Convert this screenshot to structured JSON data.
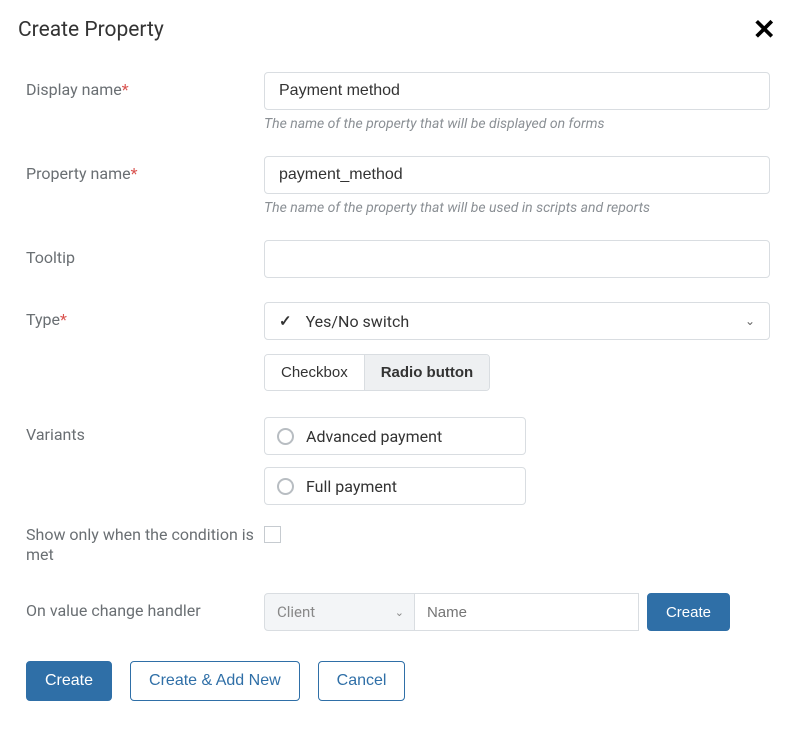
{
  "dialog": {
    "title": "Create Property"
  },
  "fields": {
    "display_name": {
      "label": "Display name",
      "required": true,
      "value": "Payment method",
      "hint": "The name of the property that will be displayed on forms"
    },
    "property_name": {
      "label": "Property name",
      "required": true,
      "value": "payment_method",
      "hint": "The name of the property that will be used in scripts and reports"
    },
    "tooltip": {
      "label": "Tooltip",
      "required": false,
      "value": ""
    },
    "type": {
      "label": "Type",
      "required": true,
      "selected": "Yes/No switch",
      "display_options": [
        "Checkbox",
        "Radio button"
      ],
      "display_selected": "Radio button"
    },
    "variants": {
      "label": "Variants",
      "items": [
        "Advanced payment",
        "Full payment"
      ]
    },
    "condition": {
      "label": "Show only when the condition is met",
      "checked": false
    },
    "handler": {
      "label": "On value change handler",
      "scope_selected": "Client",
      "name_placeholder": "Name",
      "name_value": "",
      "create_label": "Create"
    }
  },
  "footer": {
    "create": "Create",
    "create_add_new": "Create & Add New",
    "cancel": "Cancel"
  }
}
